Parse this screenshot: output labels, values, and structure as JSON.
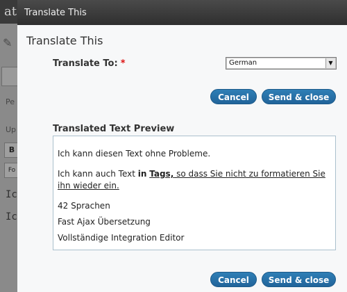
{
  "background": {
    "header_text": "ator",
    "label_pe": "Pe",
    "label_up": "Up",
    "btn_b": "B",
    "btn_fo": "Fo",
    "line1": "Ic",
    "line2": "Ic"
  },
  "dialog": {
    "window_title": "Translate This",
    "heading": "Translate This",
    "translate_to_label": "Translate To:",
    "required_mark": "*",
    "language_selected": "German",
    "cancel_label": "Cancel",
    "send_close_label": "Send & close",
    "preview_label": "Translated Text Preview",
    "preview": {
      "p1": "Ich kann diesen Text ohne Probleme.",
      "p2_start": "Ich kann auch Text ",
      "p2_bold": "in",
      "p2_space": " ",
      "p2_link": "Tags,",
      "p2_end": " so dass Sie nicht zu formatieren Sie ihn wieder ein.",
      "p3": "42 Sprachen",
      "p4": "Fast Ajax Übersetzung",
      "p5": "Vollständige Integration Editor"
    }
  },
  "colors": {
    "button_blue": "#2f7fb6",
    "titlebar": "#2f2f2f",
    "required_red": "#d11111"
  }
}
